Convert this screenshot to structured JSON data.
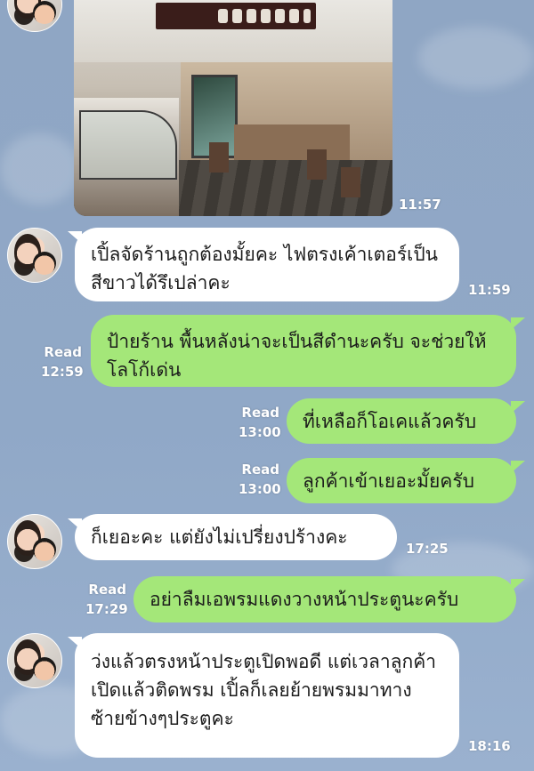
{
  "colors": {
    "background": "#90a8c7",
    "incoming_bubble": "#ffffff",
    "outgoing_bubble": "#a4e779",
    "meta_text": "#ffffff"
  },
  "photo_message": {
    "time": "11:57"
  },
  "messages": [
    {
      "direction": "in",
      "text": "เปิ้ลจัดร้านถูกต้องมั้ยคะ ไฟตรงเค้าเตอร์เป็นสีขาวได้รึเปล่าคะ",
      "time": "11:59"
    },
    {
      "direction": "out",
      "text": "ป้ายร้าน พื้นหลังน่าจะเป็นสีดำนะครับ จะช่วยให้โลโก้เด่น",
      "read": "Read",
      "time": "12:59"
    },
    {
      "direction": "out",
      "text": "ที่เหลือก็โอเคแล้วครับ",
      "read": "Read",
      "time": "13:00"
    },
    {
      "direction": "out",
      "text": "ลูกค้าเข้าเยอะมั้ยครับ",
      "read": "Read",
      "time": "13:00"
    },
    {
      "direction": "in",
      "text": "ก็เยอะคะ แต่ยังไม่เปรี่ยงปร้างคะ",
      "time": "17:25"
    },
    {
      "direction": "out",
      "text": "อย่าลืมเอพรมแดงวางหน้าประตูนะครับ",
      "read": "Read",
      "time": "17:29"
    },
    {
      "direction": "in",
      "text": "ว่งแล้วตรงหน้าประตูเปิดพอดี แต่เวลาลูกค้าเปิดแล้วติดพรม เปิ้ลก็เลยย้ายพรมมาทางซ้ายข้างๆประตูคะ",
      "time": "18:16"
    }
  ]
}
